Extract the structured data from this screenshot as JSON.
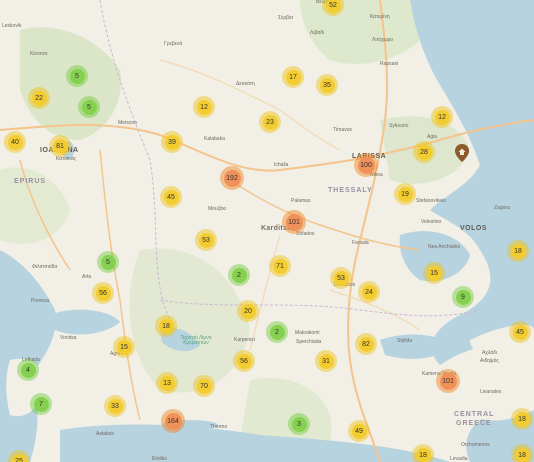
{
  "map": {
    "colors": {
      "land": "#f1efe6",
      "forest": "#d8e4c4",
      "water": "#b7d3e0",
      "road": "#f5c48c",
      "cluster_small": "#f3cc2f",
      "cluster_green": "#86d04f",
      "cluster_large": "#f0915a"
    },
    "place_labels": [
      {
        "text": "Βελβεντός",
        "cls": "s"
      },
      {
        "text": "Leskovik",
        "cls": "s"
      },
      {
        "text": "Κόνιτσα",
        "cls": "s"
      },
      {
        "text": "Γρεβενά",
        "cls": "s"
      },
      {
        "text": "Σέρβια",
        "cls": "s"
      },
      {
        "text": "Λιβαδι",
        "cls": "s"
      },
      {
        "text": "Κατερίνη",
        "cls": "s"
      },
      {
        "text": "Λιτόχωρο",
        "cls": "s"
      },
      {
        "text": "Rapsani",
        "cls": "s"
      },
      {
        "text": "Δεσκάτη",
        "cls": "s"
      },
      {
        "text": "Metsovo",
        "cls": "s"
      },
      {
        "text": "Kalabaka",
        "cls": "s"
      },
      {
        "text": "Tirnavos",
        "cls": "s"
      },
      {
        "text": "Sykourio",
        "cls": "s"
      },
      {
        "text": "Agia",
        "cls": "s"
      },
      {
        "text": "IOANNINA",
        "cls": "city"
      },
      {
        "text": "Κατσικάς",
        "cls": "s"
      },
      {
        "text": "EPIRUS",
        "cls": "r"
      },
      {
        "text": "Ichalia",
        "cls": "s"
      },
      {
        "text": "LARISSA",
        "cls": "city"
      },
      {
        "text": "Nikea",
        "cls": "s"
      },
      {
        "text": "THESSALY",
        "cls": "r"
      },
      {
        "text": "Μουζάκι",
        "cls": "s"
      },
      {
        "text": "Palamas",
        "cls": "s"
      },
      {
        "text": "Karditsa",
        "cls": "m"
      },
      {
        "text": "Sofades",
        "cls": "s"
      },
      {
        "text": "Stefanovikeio",
        "cls": "s"
      },
      {
        "text": "Zagora",
        "cls": "s"
      },
      {
        "text": "Velestino",
        "cls": "s"
      },
      {
        "text": "VOLOS",
        "cls": "city"
      },
      {
        "text": "Nea Anchialos",
        "cls": "s"
      },
      {
        "text": "Farsala",
        "cls": "s"
      },
      {
        "text": "Φιλιππιάδα",
        "cls": "s"
      },
      {
        "text": "Arta",
        "cls": "s"
      },
      {
        "text": "Domokos",
        "cls": "s"
      },
      {
        "text": "Preveza",
        "cls": "s"
      },
      {
        "text": "Vonitsa",
        "cls": "s"
      },
      {
        "text": "Agrinio",
        "cls": "s"
      },
      {
        "text": "Τεχνητή Λίμνη Κρεμαστών",
        "cls": "s g"
      },
      {
        "text": "Karpenisi",
        "cls": "s"
      },
      {
        "text": "Makrakomi",
        "cls": "s"
      },
      {
        "text": "Sperchiada",
        "cls": "s"
      },
      {
        "text": "Stylida",
        "cls": "s"
      },
      {
        "text": "Lefkada",
        "cls": "s"
      },
      {
        "text": "Αχλάδι",
        "cls": "s"
      },
      {
        "text": "Αιδηψός",
        "cls": "s"
      },
      {
        "text": "Kamena Vourla",
        "cls": "s"
      },
      {
        "text": "Livanates",
        "cls": "s"
      },
      {
        "text": "CENTRAL",
        "cls": "r"
      },
      {
        "text": "GREECE",
        "cls": "r"
      },
      {
        "text": "Thermo",
        "cls": "s"
      },
      {
        "text": "Astakos",
        "cls": "s"
      },
      {
        "text": "Orchomenos",
        "cls": "s"
      },
      {
        "text": "Etoliko",
        "cls": "s"
      },
      {
        "text": "Levadia",
        "cls": "s"
      }
    ],
    "clusters": [
      {
        "count": "52",
        "kind": "y"
      },
      {
        "count": "5",
        "kind": "gr"
      },
      {
        "count": "22",
        "kind": "y"
      },
      {
        "count": "5",
        "kind": "gr"
      },
      {
        "count": "17",
        "kind": "y"
      },
      {
        "count": "35",
        "kind": "y"
      },
      {
        "count": "12",
        "kind": "y"
      },
      {
        "count": "40",
        "kind": "y"
      },
      {
        "count": "81",
        "kind": "y"
      },
      {
        "count": "39",
        "kind": "y"
      },
      {
        "count": "23",
        "kind": "y"
      },
      {
        "count": "12",
        "kind": "y"
      },
      {
        "count": "28",
        "kind": "y"
      },
      {
        "count": "100",
        "kind": "o"
      },
      {
        "count": "192",
        "kind": "o"
      },
      {
        "count": "19",
        "kind": "y"
      },
      {
        "count": "45",
        "kind": "y"
      },
      {
        "count": "101",
        "kind": "o"
      },
      {
        "count": "53",
        "kind": "y"
      },
      {
        "count": "18",
        "kind": "y"
      },
      {
        "count": "5",
        "kind": "gr"
      },
      {
        "count": "2",
        "kind": "gr"
      },
      {
        "count": "71",
        "kind": "y"
      },
      {
        "count": "53",
        "kind": "y"
      },
      {
        "count": "15",
        "kind": "y"
      },
      {
        "count": "56",
        "kind": "y"
      },
      {
        "count": "24",
        "kind": "y"
      },
      {
        "count": "9",
        "kind": "gr"
      },
      {
        "count": "20",
        "kind": "y"
      },
      {
        "count": "18",
        "kind": "y"
      },
      {
        "count": "2",
        "kind": "gr"
      },
      {
        "count": "45",
        "kind": "y"
      },
      {
        "count": "15",
        "kind": "y"
      },
      {
        "count": "82",
        "kind": "y"
      },
      {
        "count": "56",
        "kind": "y"
      },
      {
        "count": "31",
        "kind": "y"
      },
      {
        "count": "4",
        "kind": "gr"
      },
      {
        "count": "13",
        "kind": "y"
      },
      {
        "count": "70",
        "kind": "y"
      },
      {
        "count": "101",
        "kind": "o"
      },
      {
        "count": "7",
        "kind": "gr"
      },
      {
        "count": "33",
        "kind": "y"
      },
      {
        "count": "164",
        "kind": "o"
      },
      {
        "count": "3",
        "kind": "gr"
      },
      {
        "count": "49",
        "kind": "y"
      },
      {
        "count": "18",
        "kind": "y"
      },
      {
        "count": "18",
        "kind": "y"
      },
      {
        "count": "18",
        "kind": "y"
      },
      {
        "count": "25",
        "kind": "y"
      }
    ],
    "pin": {
      "icon": "map-pin-icon",
      "color": "#8a5a2b"
    }
  }
}
